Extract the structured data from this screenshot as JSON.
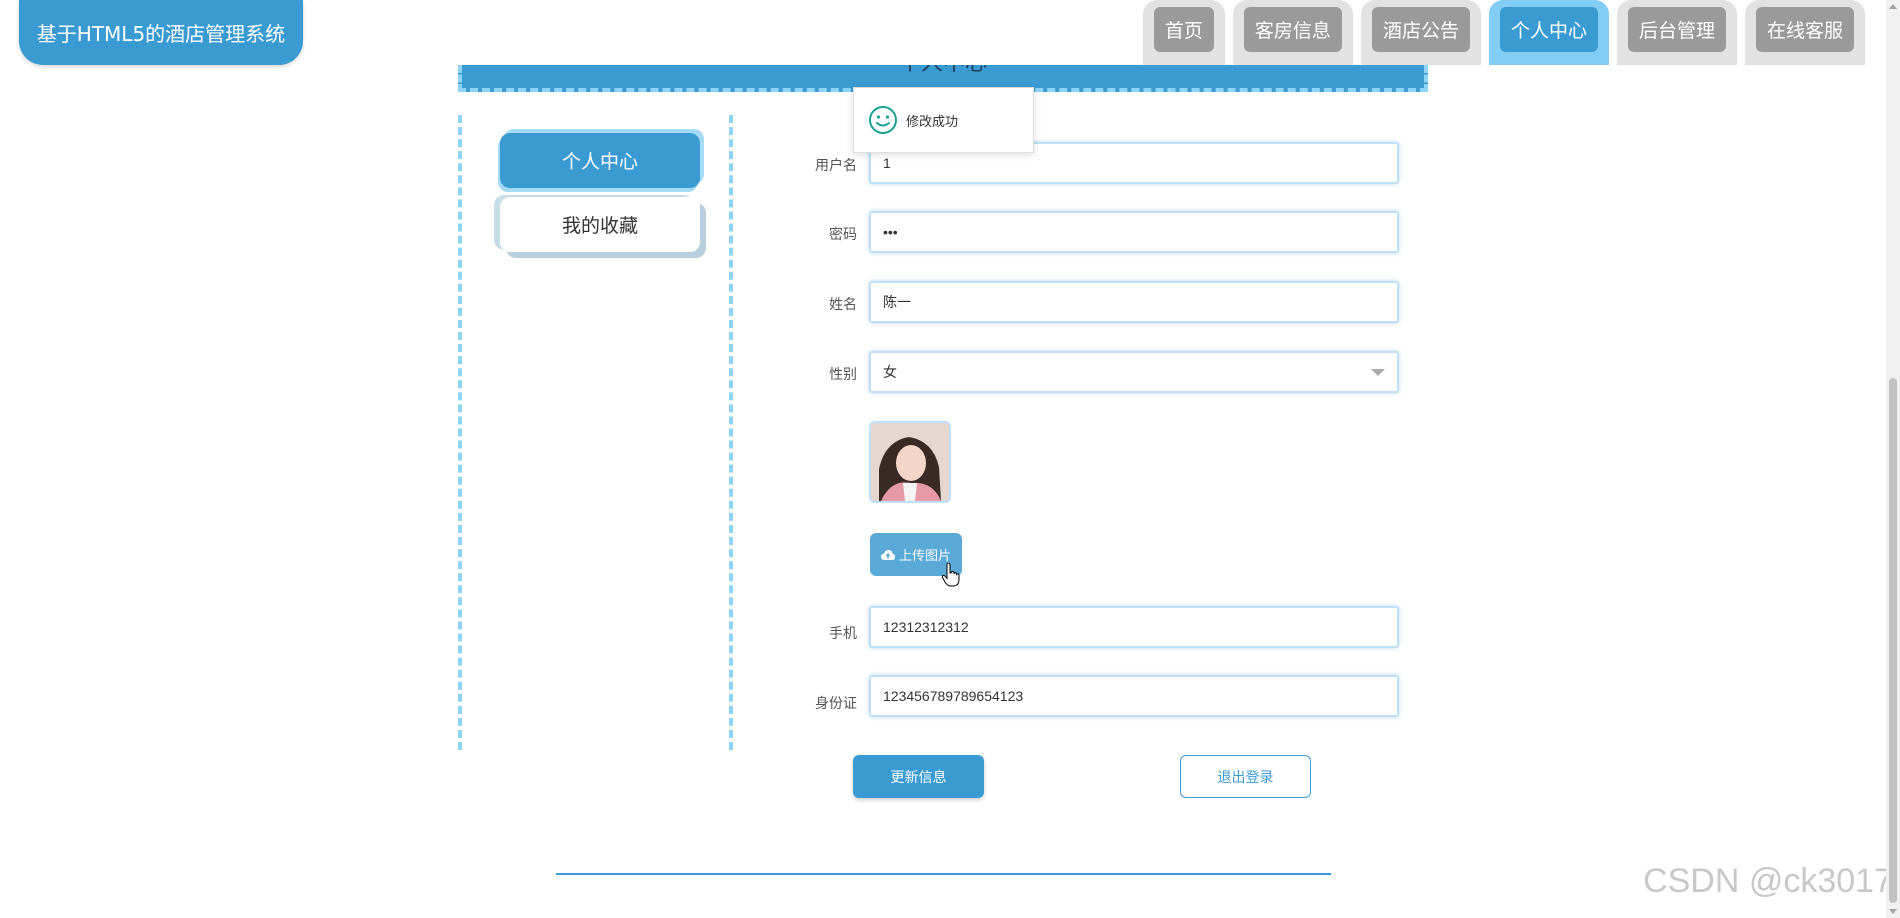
{
  "brand": {
    "title": "基于HTML5的酒店管理系统"
  },
  "nav": {
    "items": [
      {
        "label": "首页",
        "active": false
      },
      {
        "label": "客房信息",
        "active": false
      },
      {
        "label": "酒店公告",
        "active": false
      },
      {
        "label": "个人中心",
        "active": true
      },
      {
        "label": "后台管理",
        "active": false
      },
      {
        "label": "在线客服",
        "active": false
      }
    ]
  },
  "banner": {
    "title": "个人中心"
  },
  "sidebar": {
    "items": [
      {
        "label": "个人中心",
        "active": true
      },
      {
        "label": "我的收藏",
        "active": false
      }
    ]
  },
  "form": {
    "username": {
      "label": "用户名",
      "value": "1"
    },
    "password": {
      "label": "密码",
      "value": "•••"
    },
    "name": {
      "label": "姓名",
      "value": "陈一"
    },
    "gender": {
      "label": "性别",
      "value": "女"
    },
    "upload_label": "上传图片",
    "phone": {
      "label": "手机",
      "value": "12312312312"
    },
    "idcard": {
      "label": "身份证",
      "value": "123456789789654123"
    },
    "update_label": "更新信息",
    "logout_label": "退出登录"
  },
  "toast": {
    "message": "修改成功",
    "icon": "smile-icon"
  },
  "watermark": "CSDN @ck3017",
  "colors": {
    "primary": "#3a9ad2",
    "light": "#8ed4f6",
    "success": "#1aa094"
  }
}
